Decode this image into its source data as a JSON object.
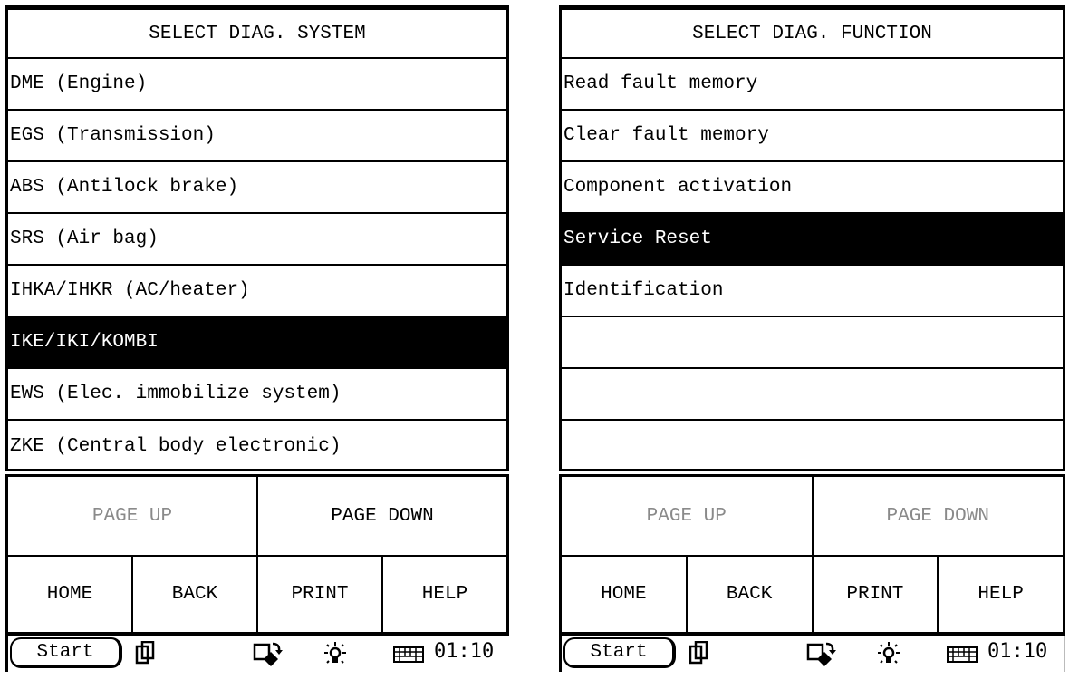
{
  "screens": [
    {
      "header": "SELECT DIAG. SYSTEM",
      "items": [
        {
          "label": "DME (Engine)",
          "selected": false
        },
        {
          "label": "EGS (Transmission)",
          "selected": false
        },
        {
          "label": "ABS (Antilock brake)",
          "selected": false
        },
        {
          "label": "SRS (Air bag)",
          "selected": false
        },
        {
          "label": "IHKA/IHKR (AC/heater)",
          "selected": false
        },
        {
          "label": "IKE/IKI/KOMBI",
          "selected": true
        },
        {
          "label": "EWS (Elec. immobilize system)",
          "selected": false
        },
        {
          "label": "ZKE (Central body electronic)",
          "selected": false
        }
      ],
      "page_up": {
        "label": "PAGE UP",
        "enabled": false
      },
      "page_down": {
        "label": "PAGE DOWN",
        "enabled": true
      },
      "nav": {
        "home": "HOME",
        "back": "BACK",
        "print": "PRINT",
        "help": "HELP"
      },
      "taskbar": {
        "start": "Start",
        "icons": [
          "windows-icon",
          "screen-rotate-icon",
          "brightness-icon",
          "keyboard-icon"
        ],
        "clock": "01:10"
      }
    },
    {
      "header": "SELECT DIAG. FUNCTION",
      "items": [
        {
          "label": "Read fault memory",
          "selected": false
        },
        {
          "label": "Clear fault memory",
          "selected": false
        },
        {
          "label": "Component activation",
          "selected": false
        },
        {
          "label": "Service Reset",
          "selected": true
        },
        {
          "label": "Identification",
          "selected": false
        },
        {
          "label": "",
          "selected": false
        },
        {
          "label": "",
          "selected": false
        },
        {
          "label": "",
          "selected": false
        }
      ],
      "page_up": {
        "label": "PAGE UP",
        "enabled": false
      },
      "page_down": {
        "label": "PAGE DOWN",
        "enabled": false
      },
      "nav": {
        "home": "HOME",
        "back": "BACK",
        "print": "PRINT",
        "help": "HELP"
      },
      "taskbar": {
        "start": "Start",
        "icons": [
          "windows-icon",
          "screen-rotate-icon",
          "brightness-icon",
          "keyboard-icon"
        ],
        "clock": "01:10"
      }
    }
  ],
  "colors": {
    "selected_bg": "#000000",
    "selected_fg": "#ffffff",
    "disabled_text": "#8a8a8a"
  }
}
